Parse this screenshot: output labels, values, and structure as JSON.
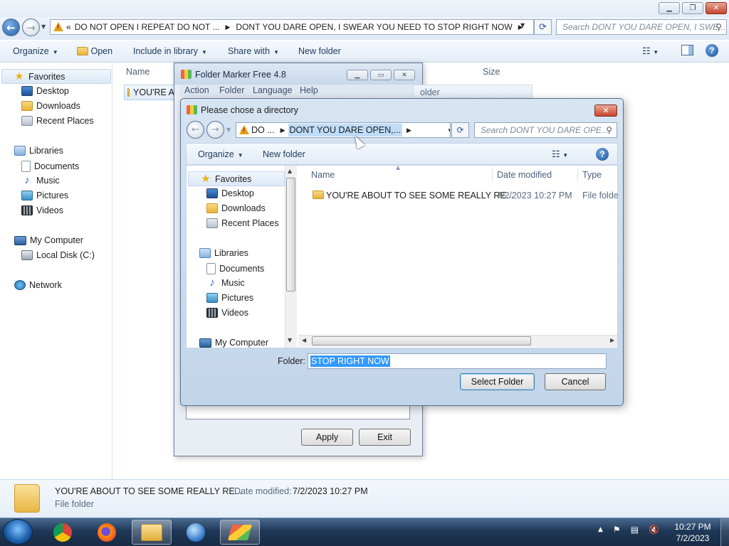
{
  "explorer": {
    "address_segments": [
      "DO NOT OPEN I REPEAT DO NOT ...",
      "DONT YOU DARE OPEN, I SWEAR YOU NEED TO STOP RIGHT NOW"
    ],
    "address_prefix": "«",
    "search_placeholder": "Search DONT YOU DARE OPEN, I SWE...",
    "toolbar": {
      "organize": "Organize",
      "open": "Open",
      "include_in_library": "Include in library",
      "share_with": "Share with",
      "new_folder": "New folder"
    },
    "nav": {
      "favorites": "Favorites",
      "desktop": "Desktop",
      "downloads": "Downloads",
      "recent_places": "Recent Places",
      "libraries": "Libraries",
      "documents": "Documents",
      "music": "Music",
      "pictures": "Pictures",
      "videos": "Videos",
      "my_computer": "My Computer",
      "local_disk": "Local Disk (C:)",
      "network": "Network"
    },
    "columns": {
      "name": "Name",
      "size": "Size"
    },
    "row_partial": "YOU'RE A",
    "details": {
      "name": "YOU'RE ABOUT TO SEE SOME REALLY RE...",
      "date_label": "Date modified:",
      "date_value": "7/2/2023 10:27 PM",
      "type": "File folder"
    }
  },
  "folder_marker": {
    "title": "Folder Marker Free 4.8",
    "menu": [
      "Action",
      "Folder",
      "Language",
      "Help"
    ],
    "behind_text": "older",
    "apply": "Apply",
    "exit": "Exit"
  },
  "dialog": {
    "title": "Please chose a directory",
    "address_prefix": "«",
    "address_seg1": "DO ...",
    "address_seg2": "DONT YOU DARE OPEN,...",
    "search_placeholder": "Search DONT YOU DARE OPE...",
    "organize": "Organize",
    "new_folder": "New folder",
    "nav": {
      "favorites": "Favorites",
      "desktop": "Desktop",
      "downloads": "Downloads",
      "recent_places": "Recent Places",
      "libraries": "Libraries",
      "documents": "Documents",
      "music": "Music",
      "pictures": "Pictures",
      "videos": "Videos",
      "my_computer": "My Computer"
    },
    "columns": {
      "name": "Name",
      "date_modified": "Date modified",
      "type": "Type"
    },
    "row": {
      "name": "YOU'RE ABOUT TO SEE SOME REALLY RE...",
      "date": "7/2/2023 10:27 PM",
      "type": "File folder"
    },
    "folder_label": "Folder:",
    "folder_value": "STOP RIGHT NOW",
    "select_folder": "Select Folder",
    "cancel": "Cancel"
  },
  "taskbar": {
    "time": "10:27 PM",
    "date": "7/2/2023"
  },
  "colors": {
    "taskbar": "#1f3857",
    "selection": "#3399ff",
    "close_red": "#c6452c"
  }
}
